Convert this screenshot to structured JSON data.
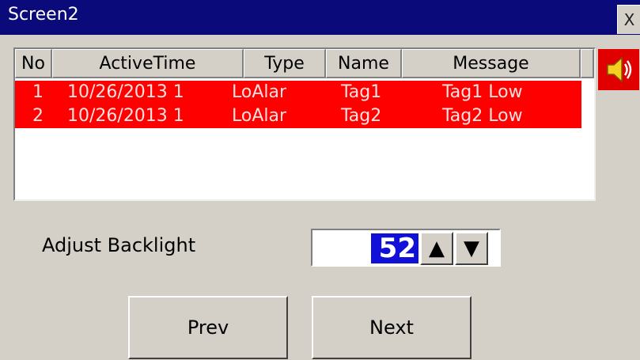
{
  "window": {
    "title": "Screen2",
    "close_label": "X"
  },
  "alarm_table": {
    "columns": [
      "No",
      "ActiveTime",
      "Type",
      "Name",
      "Message"
    ],
    "rows": [
      {
        "no": "1",
        "active_time": "10/26/2013 1",
        "type": "LoAlar",
        "name": "Tag1",
        "message": "Tag1 Low"
      },
      {
        "no": "2",
        "active_time": "10/26/2013 1",
        "type": "LoAlar",
        "name": "Tag2",
        "message": "Tag2 Low"
      }
    ],
    "row_color": "#ff0000"
  },
  "speaker_icon": "speaker-icon",
  "backlight": {
    "label": "Adjust Backlight",
    "value": "52",
    "up_label": "▲",
    "down_label": "▼"
  },
  "nav": {
    "prev_label": "Prev",
    "next_label": "Next"
  },
  "colors": {
    "titlebar": "#0a0a7a",
    "value_highlight": "#1010d8",
    "background": "#d4d0c8"
  }
}
